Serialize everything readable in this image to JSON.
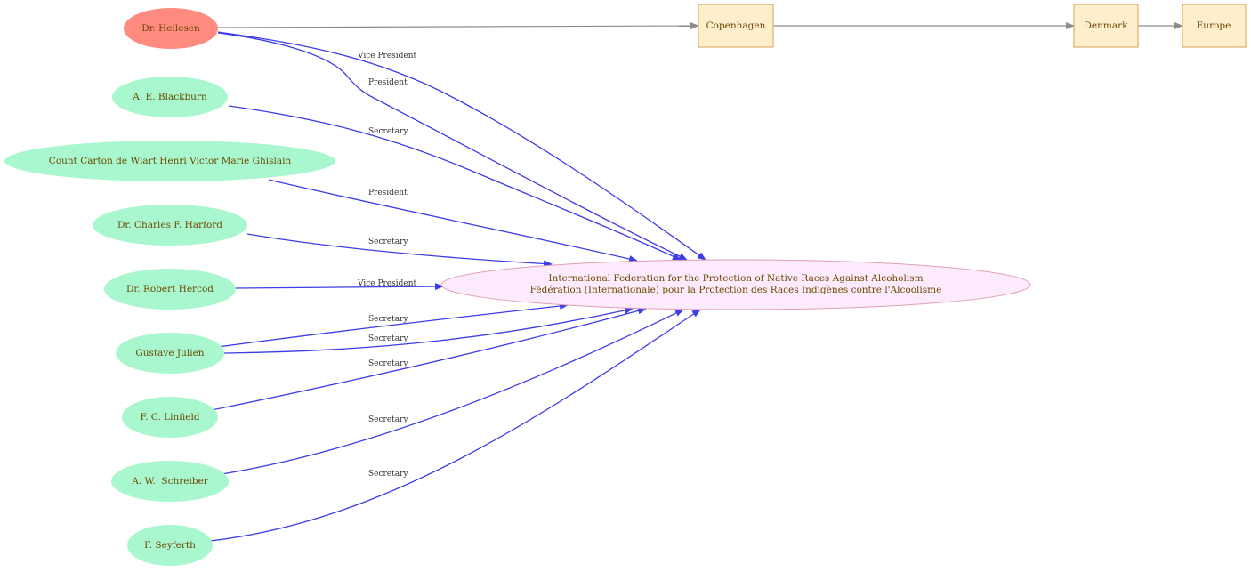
{
  "colors": {
    "person_fill": "#a9f7cf",
    "highlight_fill": "#ff8a80",
    "org_fill": "#fdeafd",
    "org_stroke": "#e0a0b0",
    "place_fill": "#ffeecc",
    "place_stroke": "#d8a050",
    "blue_edge": "#3c3ce8",
    "grey_edge": "#8c8c8c",
    "node_text": "#6b4a00"
  },
  "people": {
    "heilesen": "Dr. Heilesen",
    "blackburn": "A. E. Blackburn",
    "carton": "Count Carton de Wiart Henri Victor Marie Ghislain",
    "harford": "Dr. Charles F. Harford",
    "hercod": "Dr. Robert Hercod",
    "julien": "Gustave Julien",
    "linfield": "F. C. Linfield",
    "schreiber": "A. W.  Schreiber",
    "seyferth": "F. Seyferth"
  },
  "organization": {
    "name_en": "International Federation for the Protection of Native Races Against Alcoholism",
    "name_fr": "Fédération (Internationale) pour la Protection des Races Indigènes contre l'Alcoolisme"
  },
  "places": {
    "copenhagen": "Copenhagen",
    "denmark": "Denmark",
    "europe": "Europe"
  },
  "edge_labels": {
    "heilesen_vp": "Vice President",
    "heilesen_president": "President",
    "blackburn": "Secretary",
    "carton": "President",
    "harford": "Secretary",
    "hercod": "Vice President",
    "julien_1": "Secretary",
    "julien_2": "Secretary",
    "linfield": "Secretary",
    "schreiber": "Secretary",
    "seyferth": "Secretary"
  }
}
